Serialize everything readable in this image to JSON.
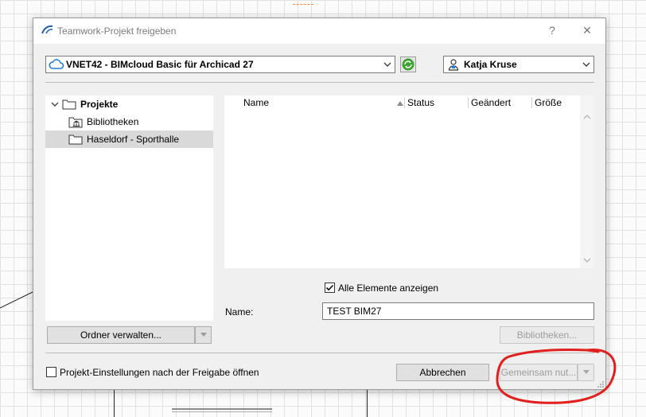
{
  "dialog": {
    "title": "Teamwork-Projekt freigeben",
    "help_glyph": "?",
    "close_glyph": "✕"
  },
  "server_select": {
    "value": "VNET42 - BIMcloud Basic für Archicad 27"
  },
  "user_select": {
    "value": "Katja Kruse"
  },
  "tree": {
    "root": "Projekte",
    "items": [
      "Bibliotheken",
      "Haseldorf - Sporthalle"
    ],
    "selected_index": 1
  },
  "file_list": {
    "columns": [
      "Name",
      "Status",
      "Geändert",
      "Größe"
    ]
  },
  "show_all": {
    "label": "Alle Elemente anzeigen",
    "checked": true
  },
  "name_field": {
    "label": "Name:",
    "value": "TEST BIM27"
  },
  "buttons": {
    "manage_folders": "Ordner verwalten...",
    "libraries": "Bibliotheken...",
    "cancel": "Abbrechen",
    "share": "Gemeinsam nut..."
  },
  "open_settings": {
    "label": "Projekt-Einstellungen nach der Freigabe öffnen",
    "checked": false
  },
  "colors": {
    "annotation": "#e0201c",
    "selection": "#d9d9d9",
    "accent": "#1e7fd8"
  }
}
